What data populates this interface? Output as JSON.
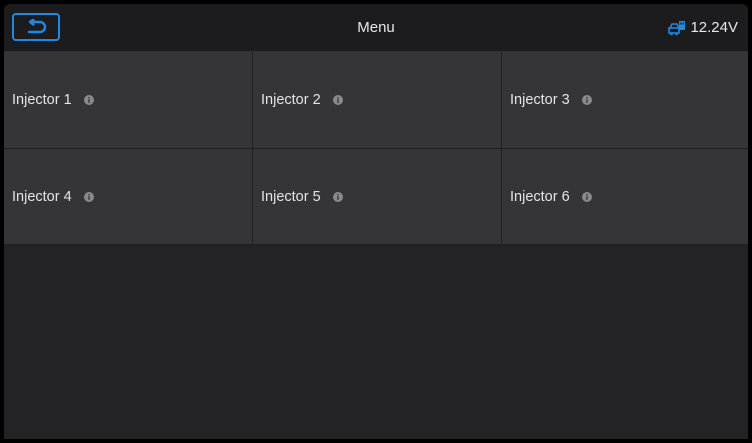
{
  "header": {
    "title": "Menu",
    "voltage": "12.24V",
    "back_icon": "back-arrow-icon",
    "battery_icon": "vehicle-battery-icon",
    "accent_color": "#1e88e5"
  },
  "menu": {
    "items": [
      {
        "label": "Injector 1",
        "icon": "info-icon"
      },
      {
        "label": "Injector 2",
        "icon": "info-icon"
      },
      {
        "label": "Injector 3",
        "icon": "info-icon"
      },
      {
        "label": "Injector 4",
        "icon": "info-icon"
      },
      {
        "label": "Injector 5",
        "icon": "info-icon"
      },
      {
        "label": "Injector 6",
        "icon": "info-icon"
      }
    ]
  }
}
